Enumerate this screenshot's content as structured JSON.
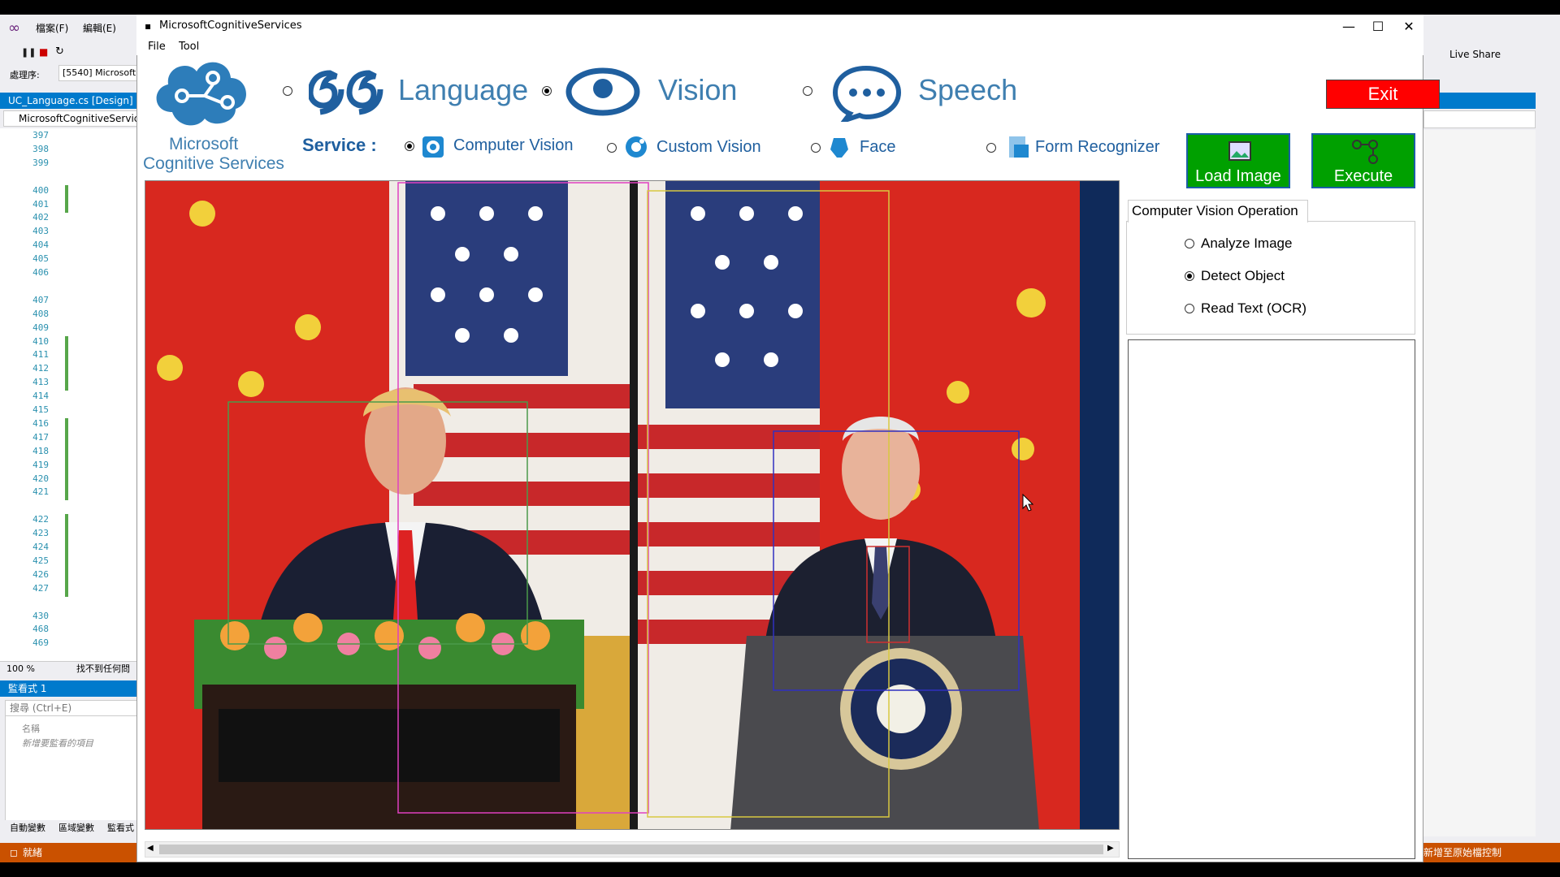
{
  "vs": {
    "menu_file": "檔案(F)",
    "menu_edit": "編輯(E)",
    "process_label": "處理序:",
    "process_value": "[5540] Microsoft",
    "doc_tab": "UC_Language.cs [Design]",
    "combo": "MicrosoftCognitiveServic",
    "line_numbers": [
      "397",
      "398",
      "399",
      "",
      "400",
      "401",
      "402",
      "403",
      "404",
      "405",
      "406",
      "",
      "407",
      "408",
      "409",
      "410",
      "411",
      "412",
      "413",
      "414",
      "415",
      "416",
      "417",
      "418",
      "419",
      "420",
      "421",
      "",
      "422",
      "423",
      "424",
      "425",
      "426",
      "427",
      "",
      "430",
      "468",
      "469"
    ],
    "zoom": "100 %",
    "zoom_status": "找不到任何問",
    "watch_title": "監看式 1",
    "watch_search": "搜尋 (Ctrl+E)",
    "watch_name_col": "名稱",
    "watch_add": "新增要監看的項目",
    "bottom_tabs": [
      "自動變數",
      "區域變數",
      "監看式"
    ],
    "status": "就緒",
    "status_right": "新增至原始檔控制",
    "live_share": "Live Share"
  },
  "window": {
    "title": "MicrosoftCognitiveServices",
    "menu": [
      "File",
      "Tool"
    ],
    "minimize": "—",
    "maximize": "☐",
    "close": "✕"
  },
  "logo": {
    "line1": "Microsoft",
    "line2": "Cognitive Services"
  },
  "categories": [
    {
      "label": "Language",
      "selected": false
    },
    {
      "label": "Vision",
      "selected": true
    },
    {
      "label": "Speech",
      "selected": false
    }
  ],
  "exit_label": "Exit",
  "service_label": "Service :",
  "services": [
    {
      "label": "Computer Vision",
      "selected": true
    },
    {
      "label": "Custom Vision",
      "selected": false
    },
    {
      "label": "Face",
      "selected": false
    },
    {
      "label": "Form Recognizer",
      "selected": false
    }
  ],
  "load_image_label": "Load Image",
  "execute_label": "Execute",
  "operation": {
    "title": "Computer Vision Operation",
    "options": [
      {
        "label": "Analyze Image",
        "selected": false
      },
      {
        "label": "Detect Object",
        "selected": true
      },
      {
        "label": "Read Text (OCR)",
        "selected": false
      }
    ]
  },
  "colors": {
    "accent": "#1f5f9f",
    "exit": "#ff0000",
    "action": "#00a000",
    "box_green": "#4a9a4a",
    "box_magenta": "#e040c0",
    "box_yellow": "#d8c840",
    "box_blue": "#3030c0",
    "box_red": "#d03030"
  }
}
